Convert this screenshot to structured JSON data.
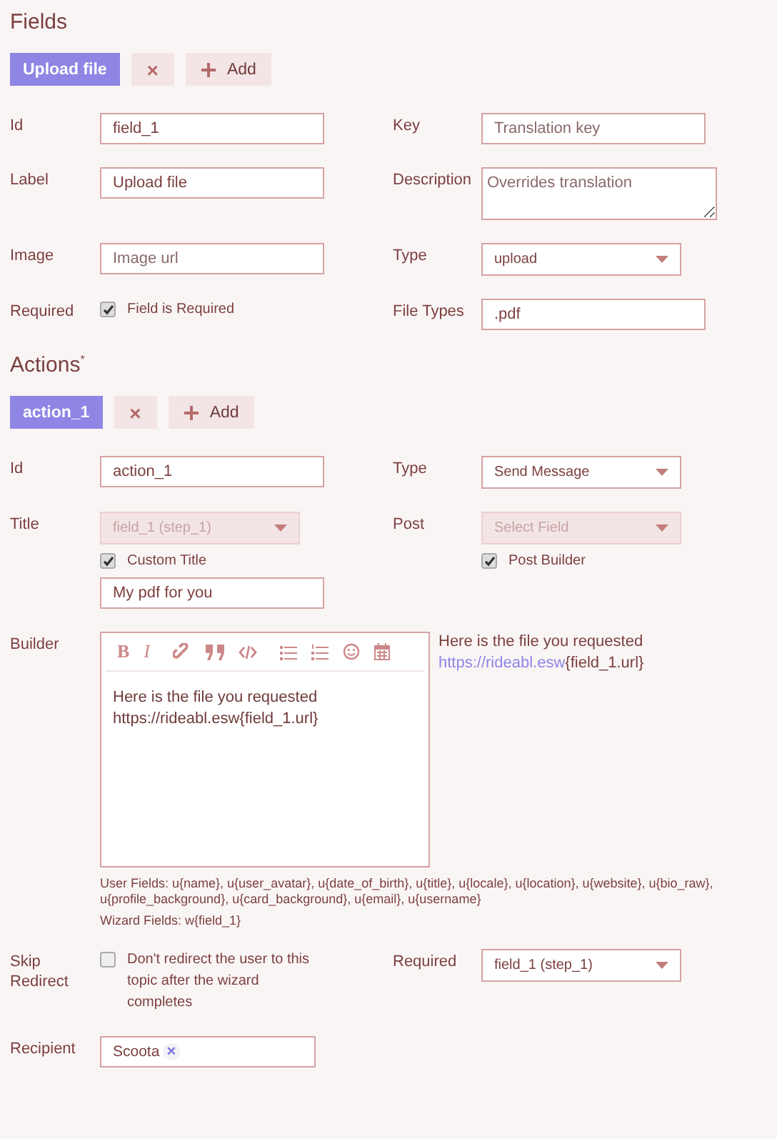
{
  "sections": [
    {
      "heading": "Fields",
      "tabs": [
        {
          "label": "Upload file",
          "selected": true
        }
      ],
      "remove": "×",
      "add": "Add",
      "rows": [
        {
          "cells": [
            {
              "label": "Id",
              "controls": [
                {
                  "kind": "input",
                  "value": "field_1"
                }
              ]
            },
            {
              "label": "Key",
              "controls": [
                {
                  "kind": "input",
                  "placeholder": "Translation key"
                }
              ]
            }
          ]
        },
        {
          "cells": [
            {
              "label": "Label",
              "controls": [
                {
                  "kind": "input",
                  "value": "Upload file"
                }
              ]
            },
            {
              "label": "Description",
              "controls": [
                {
                  "kind": "textarea",
                  "placeholder": "Overrides translation"
                }
              ]
            }
          ]
        },
        {
          "cells": [
            {
              "label": "Image",
              "controls": [
                {
                  "kind": "input",
                  "placeholder": "Image url"
                }
              ]
            },
            {
              "label": "Type",
              "controls": [
                {
                  "kind": "select",
                  "value": "upload",
                  "disabled": false
                }
              ]
            }
          ]
        },
        {
          "cells": [
            {
              "label": "Required",
              "controls": [
                {
                  "kind": "checkbox",
                  "text": "Field is Required",
                  "checked": true
                }
              ]
            },
            {
              "label": "File Types",
              "controls": [
                {
                  "kind": "input",
                  "value": ".pdf"
                }
              ]
            }
          ]
        }
      ]
    },
    {
      "heading": "Actions$^{*}$",
      "tabs": [
        {
          "label": "action_1",
          "selected": true
        }
      ],
      "remove": "×",
      "add": "Add",
      "rows": [
        {
          "cells": [
            {
              "label": "Id",
              "controls": [
                {
                  "kind": "input",
                  "value": "action_1"
                }
              ]
            },
            {
              "label": "Type",
              "controls": [
                {
                  "kind": "select",
                  "value": "Send Message",
                  "disabled": false
                }
              ]
            }
          ]
        },
        {
          "cells": [
            {
              "label": "Title",
              "controls": [
                {
                  "kind": "select",
                  "value": "field_1 (step_1)",
                  "disabled": true
                },
                {
                  "kind": "checkbox",
                  "text": "Custom Title",
                  "checked": true
                },
                {
                  "kind": "input",
                  "value": "My pdf for you"
                }
              ]
            },
            {
              "label": "Post",
              "controls": [
                {
                  "kind": "select",
                  "value": "Select Field",
                  "disabled": true
                },
                {
                  "kind": "checkbox",
                  "text": "Post Builder",
                  "checked": true
                }
              ]
            }
          ]
        },
        {
          "kind": "builder",
          "label": "Builder",
          "toolbar_glyphs": [
            "B",
            "I"
          ],
          "content": [
            "Here is the file you requested",
            "https://rideabl.esw{field_1.url}"
          ],
          "preview_text": "Here is the file you requested",
          "preview_link": "https://rideabl.esw",
          "preview_rest": "{field_1.url}",
          "help": [
            "User Fields: u{name}, u{user_avatar}, u{date_of_birth}, u{title}, u{locale}, u{location}, u{website}, u{bio_raw}, u{profile_background}, u{card_background}, u{email}, u{username}",
            "Wizard Fields: w{field_1}"
          ]
        },
        {
          "cells": [
            {
              "label": "Skip Redirect",
              "controls": [
                {
                  "kind": "checkbox",
                  "text": "Don't redirect the user to this topic after the wizard completes",
                  "checked": false
                }
              ]
            },
            {
              "label": "Required",
              "controls": [
                {
                  "kind": "select",
                  "value": "field_1 (step_1)",
                  "disabled": false
                }
              ]
            }
          ]
        },
        {
          "cells": [
            {
              "label": "Recipient",
              "controls": [
                {
                  "kind": "tags",
                  "tags": [
                    {
                      "label": "Scoota",
                      "remove": "×"
                    }
                  ]
                }
              ]
            }
          ]
        }
      ]
    }
  ]
}
